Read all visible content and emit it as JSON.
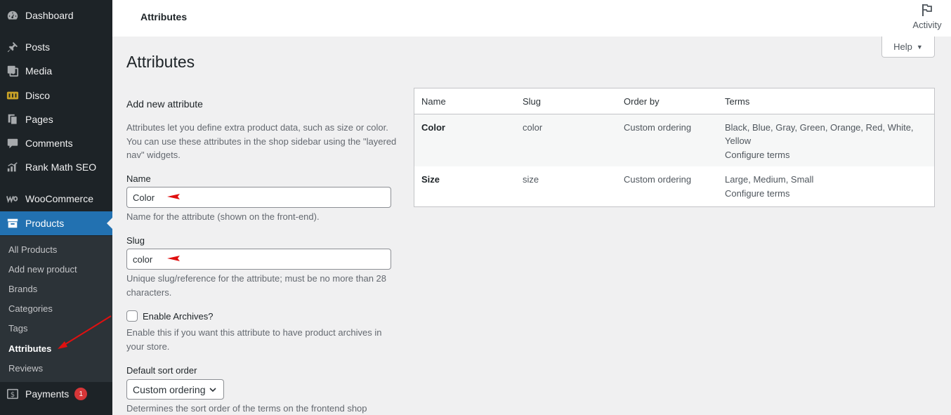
{
  "sidebar": {
    "items": [
      {
        "label": "Dashboard",
        "icon": "dashboard-icon"
      },
      {
        "label": "Posts",
        "icon": "pin-icon"
      },
      {
        "label": "Media",
        "icon": "media-icon"
      },
      {
        "label": "Disco",
        "icon": "disco-icon"
      },
      {
        "label": "Pages",
        "icon": "pages-icon"
      },
      {
        "label": "Comments",
        "icon": "comment-icon"
      },
      {
        "label": "Rank Math SEO",
        "icon": "rank-math-icon"
      },
      {
        "label": "WooCommerce",
        "icon": "woocommerce-icon"
      },
      {
        "label": "Products",
        "icon": "archive-icon"
      },
      {
        "label": "Payments",
        "icon": "dollar-icon",
        "badge": "1"
      }
    ],
    "submenu": [
      "All Products",
      "Add new product",
      "Brands",
      "Categories",
      "Tags",
      "Attributes",
      "Reviews"
    ]
  },
  "topbar": {
    "title": "Attributes",
    "activity_label": "Activity",
    "help_label": "Help"
  },
  "page": {
    "title": "Attributes"
  },
  "form": {
    "heading": "Add new attribute",
    "intro": "Attributes let you define extra product data, such as size or color. You can use these attributes in the shop sidebar using the \"layered nav\" widgets.",
    "name_label": "Name",
    "name_value": "Color",
    "name_desc": "Name for the attribute (shown on the front-end).",
    "slug_label": "Slug",
    "slug_value": "color",
    "slug_desc": "Unique slug/reference for the attribute; must be no more than 28 characters.",
    "archives_label": "Enable Archives?",
    "archives_checked": false,
    "archives_desc": "Enable this if you want this attribute to have product archives in your store.",
    "sort_label": "Default sort order",
    "sort_value": "Custom ordering",
    "sort_desc": "Determines the sort order of the terms on the frontend shop"
  },
  "table": {
    "headers": [
      "Name",
      "Slug",
      "Order by",
      "Terms"
    ],
    "rows": [
      {
        "name": "Color",
        "slug": "color",
        "order": "Custom ordering",
        "terms_line1": "Black, Blue, Gray, Green, Orange, Red, White,",
        "terms_line2": "Yellow",
        "configure": "Configure terms"
      },
      {
        "name": "Size",
        "slug": "size",
        "order": "Custom ordering",
        "terms_line1": "Large, Medium, Small",
        "configure": "Configure terms"
      }
    ]
  },
  "colors": {
    "sidebar_bg": "#1d2327",
    "submenu_bg": "#2c3338",
    "accent": "#2271b1",
    "badge": "#d63638",
    "annotation_arrow": "#e01010"
  }
}
